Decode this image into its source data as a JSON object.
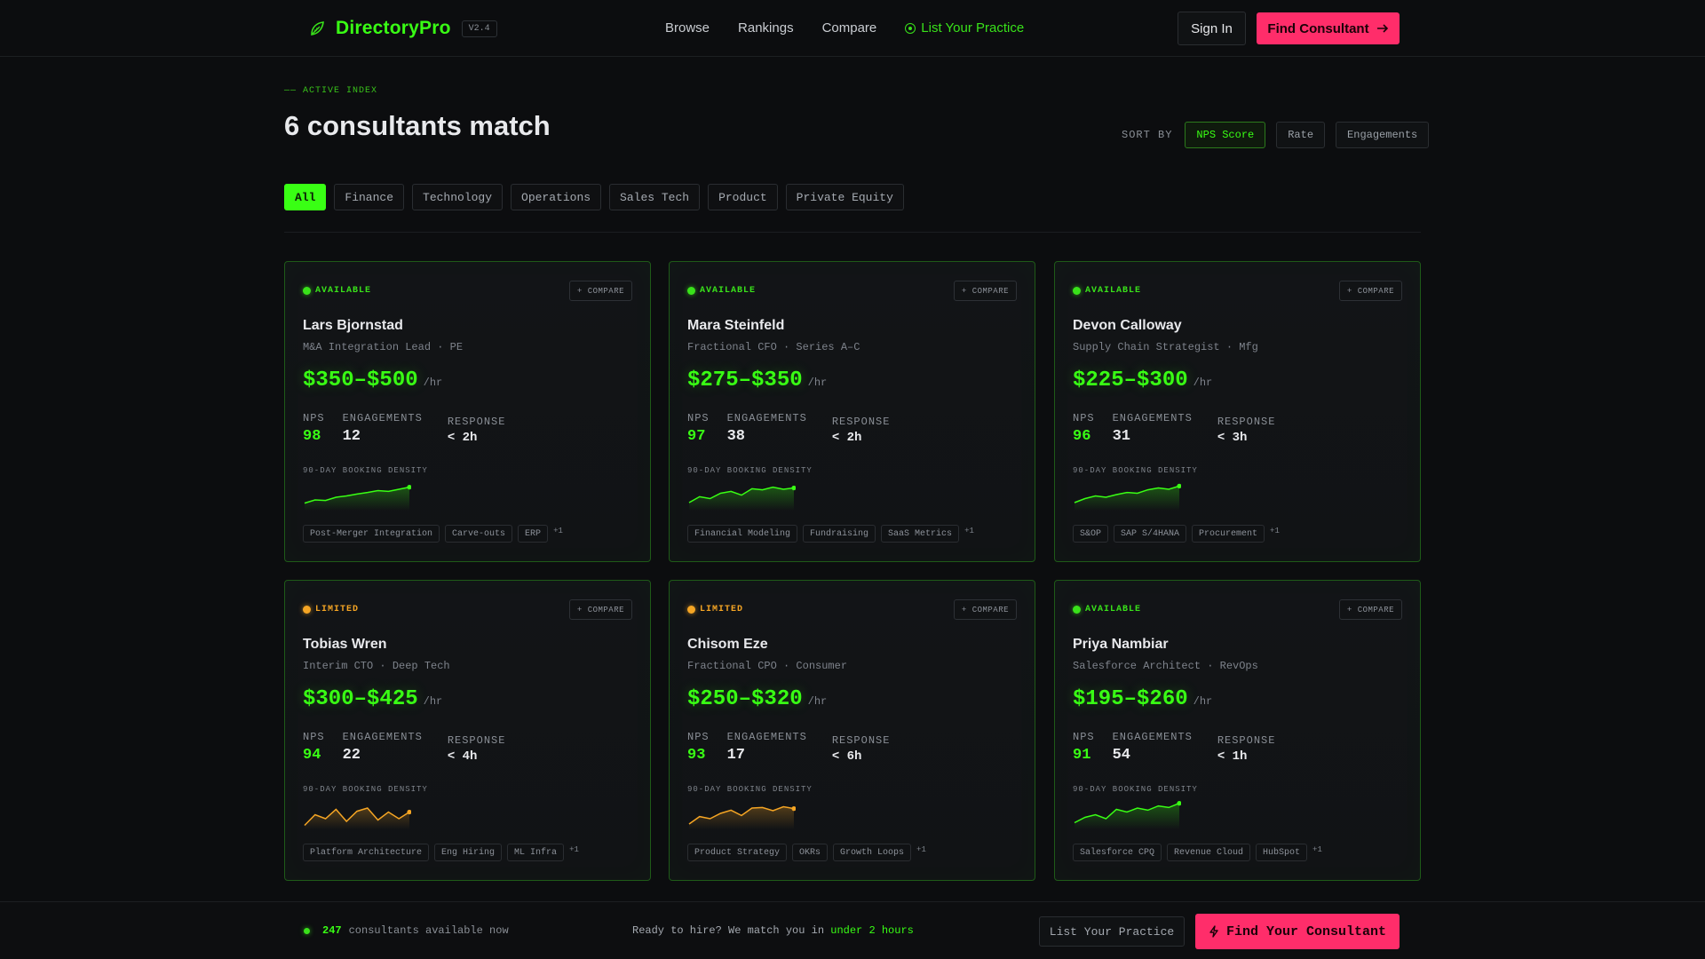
{
  "brand": {
    "name": "DirectoryPro",
    "version": "V2.4",
    "icon": "leaf-icon"
  },
  "nav": {
    "items": [
      "Browse",
      "Rankings",
      "Compare"
    ],
    "cta": "List Your Practice",
    "sign_in": "Sign In",
    "find": "Find Consultant"
  },
  "hero": {
    "eyebrow": "—— ACTIVE INDEX",
    "title": "6 consultants match"
  },
  "sort": {
    "label": "SORT BY",
    "options": [
      "NPS Score",
      "Rate",
      "Engagements"
    ],
    "active": "NPS Score"
  },
  "filters": {
    "options": [
      "All",
      "Finance",
      "Technology",
      "Operations",
      "Sales Tech",
      "Product",
      "Private Equity"
    ],
    "active": "All"
  },
  "card_labels": {
    "compare": "+ COMPARE",
    "unit": "/hr",
    "nps": "NPS",
    "engagements": "ENGAGEMENTS",
    "response": "RESPONSE",
    "density": "90-DAY BOOKING DENSITY"
  },
  "colors": {
    "accent": "#39ff14",
    "cta": "#ff2d6a",
    "limited": "#f5a524",
    "background": "#0c0d0f"
  },
  "consultants": [
    {
      "status": "AVAILABLE",
      "name": "Lars Bjornstad",
      "role": "M&A Integration Lead · PE",
      "rate": "$350–$500",
      "nps": "98",
      "engagements": "12",
      "response": "< 2h",
      "tags": [
        "Post-Merger Integration",
        "Carve-outs",
        "ERP"
      ],
      "more": "+1",
      "density": [
        0.18,
        0.3,
        0.28,
        0.4,
        0.45,
        0.52,
        0.58,
        0.65,
        0.62,
        0.7,
        0.78
      ]
    },
    {
      "status": "AVAILABLE",
      "name": "Mara Steinfeld",
      "role": "Fractional CFO · Series A–C",
      "rate": "$275–$350",
      "nps": "97",
      "engagements": "38",
      "response": "< 2h",
      "tags": [
        "Financial Modeling",
        "Fundraising",
        "SaaS Metrics"
      ],
      "more": "+1",
      "density": [
        0.2,
        0.42,
        0.35,
        0.55,
        0.62,
        0.48,
        0.72,
        0.68,
        0.78,
        0.7,
        0.75
      ]
    },
    {
      "status": "AVAILABLE",
      "name": "Devon Calloway",
      "role": "Supply Chain Strategist · Mfg",
      "rate": "$225–$300",
      "nps": "96",
      "engagements": "31",
      "response": "< 3h",
      "tags": [
        "S&OP",
        "SAP S/4HANA",
        "Procurement"
      ],
      "more": "+1",
      "density": [
        0.2,
        0.35,
        0.45,
        0.4,
        0.5,
        0.58,
        0.55,
        0.68,
        0.75,
        0.7,
        0.82
      ]
    },
    {
      "status": "LIMITED",
      "name": "Tobias Wren",
      "role": "Interim CTO · Deep Tech",
      "rate": "$300–$425",
      "nps": "94",
      "engagements": "22",
      "response": "< 4h",
      "tags": [
        "Platform Architecture",
        "Eng Hiring",
        "ML Infra"
      ],
      "more": "+1",
      "density": [
        0.05,
        0.45,
        0.3,
        0.65,
        0.2,
        0.58,
        0.7,
        0.25,
        0.55,
        0.3,
        0.55
      ]
    },
    {
      "status": "LIMITED",
      "name": "Chisom Eze",
      "role": "Fractional CPO · Consumer",
      "rate": "$250–$320",
      "nps": "93",
      "engagements": "17",
      "response": "< 6h",
      "tags": [
        "Product Strategy",
        "OKRs",
        "Growth Loops"
      ],
      "more": "+1",
      "density": [
        0.1,
        0.38,
        0.3,
        0.5,
        0.62,
        0.42,
        0.7,
        0.72,
        0.6,
        0.75,
        0.68
      ]
    },
    {
      "status": "AVAILABLE",
      "name": "Priya Nambiar",
      "role": "Salesforce Architect · RevOps",
      "rate": "$195–$260",
      "nps": "91",
      "engagements": "54",
      "response": "< 1h",
      "tags": [
        "Salesforce CPQ",
        "Revenue Cloud",
        "HubSpot"
      ],
      "more": "+1",
      "density": [
        0.15,
        0.35,
        0.45,
        0.3,
        0.65,
        0.55,
        0.7,
        0.62,
        0.78,
        0.72,
        0.88
      ]
    }
  ],
  "footer": {
    "count": "247",
    "count_text": "consultants available now",
    "ready_text": "Ready to hire? We match you in",
    "ready_highlight": "under 2 hours",
    "list": "List Your Practice",
    "find": "Find Your Consultant"
  }
}
